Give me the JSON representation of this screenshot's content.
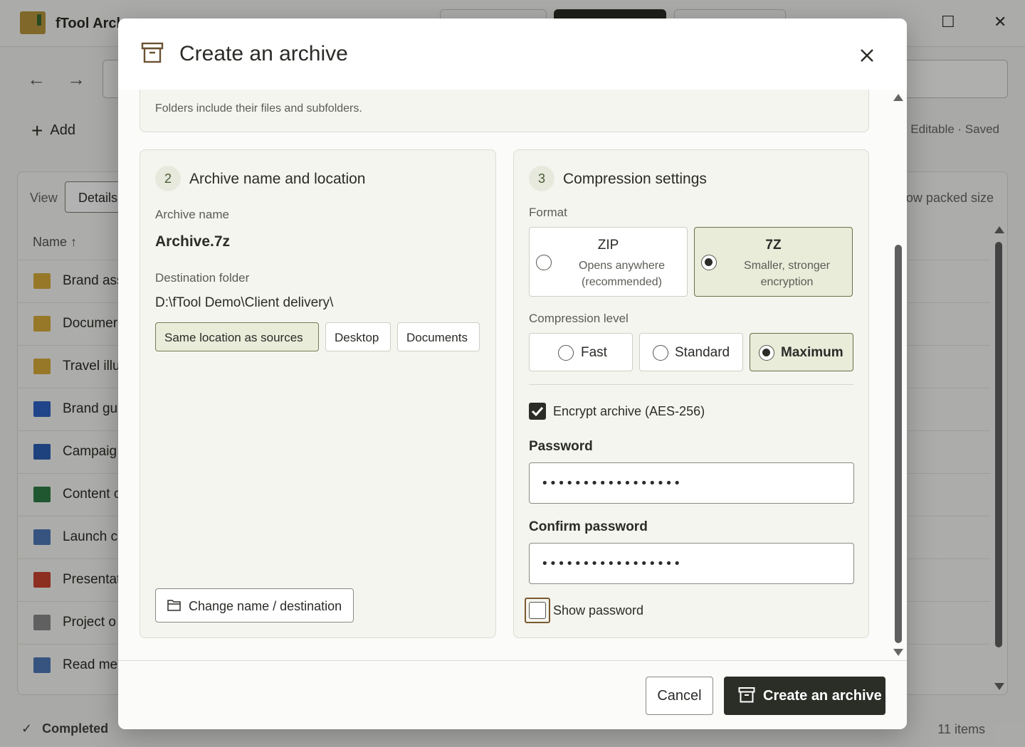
{
  "app": {
    "title": "fTool Arch",
    "toolbar": {
      "add_label": "Add"
    },
    "status_right": "Editable · Saved",
    "view_label": "View",
    "view_value": "Details",
    "packed_size_label": "ow packed size",
    "name_column": "Name ↑",
    "rows": [
      {
        "name": "Brand ass",
        "icon": "folder-icon"
      },
      {
        "name": "Documer",
        "icon": "folder-icon"
      },
      {
        "name": "Travel illu",
        "icon": "folder-icon"
      },
      {
        "name": "Brand gu",
        "icon": "document-icon"
      },
      {
        "name": "Campaig",
        "icon": "word-icon"
      },
      {
        "name": "Content c",
        "icon": "excel-icon"
      },
      {
        "name": "Launch c",
        "icon": "download-file-icon"
      },
      {
        "name": "Presentat",
        "icon": "powerpoint-icon"
      },
      {
        "name": "Project o",
        "icon": "notepad-icon"
      },
      {
        "name": "Read me.",
        "icon": "download-file-icon"
      }
    ],
    "status_done": "Completed",
    "item_count": "11 items"
  },
  "dialog": {
    "title": "Create an archive",
    "section1": {
      "hint": "Folders include their files and subfolders."
    },
    "section2": {
      "step": "2",
      "title": "Archive name and location",
      "archive_name_label": "Archive name",
      "archive_name": "Archive.7z",
      "destination_label": "Destination folder",
      "destination_path": "D:\\fTool Demo\\Client delivery\\",
      "location_options": [
        "Same location as sources",
        "Desktop",
        "Documents"
      ],
      "change_button": "Change name / destination"
    },
    "section3": {
      "step": "3",
      "title": "Compression settings",
      "format_label": "Format",
      "formats": [
        {
          "name": "ZIP",
          "desc": "Opens anywhere (recommended)",
          "selected": false
        },
        {
          "name": "7Z",
          "desc": "Smaller, stronger encryption",
          "selected": true
        }
      ],
      "level_label": "Compression level",
      "levels": [
        "Fast",
        "Standard",
        "Maximum"
      ],
      "selected_level": "Maximum",
      "encrypt_label": "Encrypt archive (AES-256)",
      "encrypt_checked": true,
      "password_label": "Password",
      "password_value": "•••••••••••••••••",
      "confirm_label": "Confirm password",
      "confirm_value": "•••••••••••••••••",
      "show_password_label": "Show password",
      "show_password_checked": false
    },
    "footer": {
      "cancel": "Cancel",
      "create": "Create an archive"
    }
  },
  "colors": {
    "accent_selected_bg": "#e8ecd9",
    "primary_button": "#2b2d27",
    "focus_ring": "#7a5a2e"
  }
}
